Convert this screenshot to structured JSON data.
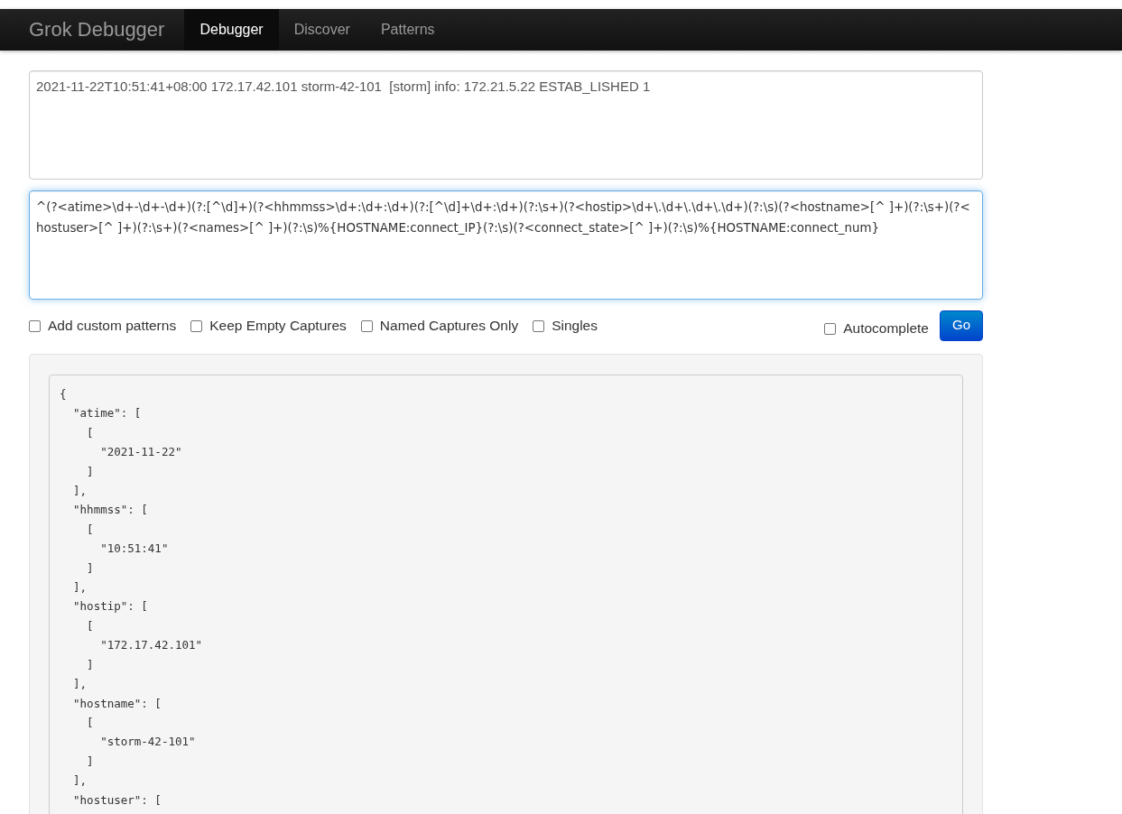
{
  "navbar": {
    "brand": "Grok Debugger",
    "tabs": [
      {
        "label": "Debugger",
        "selected": true
      },
      {
        "label": "Discover",
        "selected": false
      },
      {
        "label": "Patterns",
        "selected": false
      }
    ]
  },
  "input": {
    "value": "2021-11-22T10:51:41+08:00 172.17.42.101 storm-42-101  [storm] info: 172.21.5.22 ESTAB_LISHED 1"
  },
  "pattern": {
    "value": "^(?<atime>\\d+-\\d+-\\d+)(?:[^\\d]+)(?<hhmmss>\\d+:\\d+:\\d+)(?:[^\\d]+\\d+:\\d+)(?:\\s+)(?<hostip>\\d+\\.\\d+\\.\\d+\\.\\d+)(?:\\s)(?<hostname>[^ ]+)(?:\\s+)(?<hostuser>[^ ]+)(?:\\s+)(?<names>[^ ]+)(?:\\s)%{HOSTNAME:connect_IP}(?:\\s)(?<connect_state>[^ ]+)(?:\\s)%{HOSTNAME:connect_num}",
    "focused": true
  },
  "options": [
    {
      "label": "Add custom patterns",
      "checked": false
    },
    {
      "label": "Keep Empty Captures",
      "checked": false
    },
    {
      "label": "Named Captures Only",
      "checked": false
    },
    {
      "label": "Singles",
      "checked": false
    }
  ],
  "autocomplete": {
    "label": "Autocomplete",
    "checked": false
  },
  "go_button": "Go",
  "output_lines": [
    "{",
    "  \"atime\": [",
    "    [",
    "      \"2021-11-22\"",
    "    ]",
    "  ],",
    "  \"hhmmss\": [",
    "    [",
    "      \"10:51:41\"",
    "    ]",
    "  ],",
    "  \"hostip\": [",
    "    [",
    "      \"172.17.42.101\"",
    "    ]",
    "  ],",
    "  \"hostname\": [",
    "    [",
    "      \"storm-42-101\"",
    "    ]",
    "  ],",
    "  \"hostuser\": ["
  ]
}
